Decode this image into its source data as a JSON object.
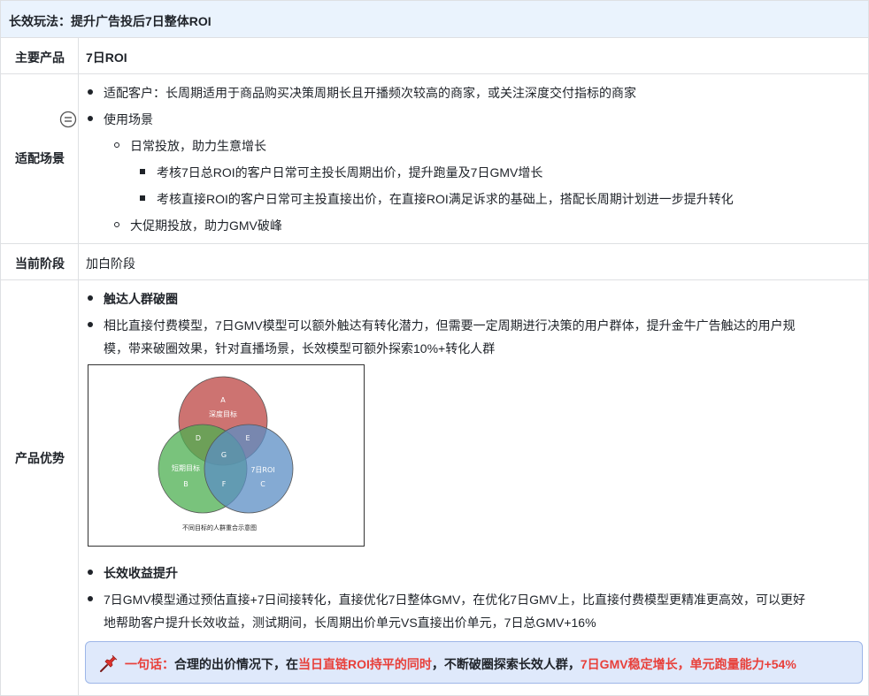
{
  "header": {
    "title": "长效玩法：提升广告投后7日整体ROI"
  },
  "rows": {
    "product": {
      "label": "主要产品",
      "value": "7日ROI"
    },
    "scene": {
      "label": "适配场景",
      "b1": "适配客户：长周期适用于商品购买决策周期长且开播频次较高的商家，或关注深度交付指标的商家",
      "b2": "使用场景",
      "s1": "日常投放，助力生意增长",
      "t1": "考核7日总ROI的客户日常可主投长周期出价，提升跑量及7日GMV增长",
      "t2": "考核直接ROI的客户日常可主投直接出价，在直接ROI满足诉求的基础上，搭配长周期计划进一步提升转化",
      "s2": "大促期投放，助力GMV破峰"
    },
    "stage": {
      "label": "当前阶段",
      "value": "加白阶段"
    },
    "advantage": {
      "label": "产品优势",
      "h1": "触达人群破圈",
      "p1_line1": "相比直接付费模型，7日GMV模型可以额外触达有转化潜力，但需要一定周期进行决策的用户群体，提升金牛广告触达的用户规",
      "p1_line2": "模，带来破圈效果，针对直播场景，长效模型可额外探索10%+转化人群",
      "venn": {
        "A": "A",
        "B": "B",
        "C": "C",
        "D": "D",
        "E": "E",
        "F": "F",
        "G": "G",
        "deep": "深度目标",
        "short": "短期目标",
        "roi7": "7日ROI",
        "caption": "不同目标的人群重合示意图",
        "colors": {
          "red": "#c0504d",
          "green": "#4caf50",
          "blue": "#5b8ec4"
        }
      },
      "h2": "长效收益提升",
      "p2_line1": "7日GMV模型通过预估直接+7日间接转化，直接优化7日整体GMV，在优化7日GMV上，比直接付费模型更精准更高效，可以更好",
      "p2_line2": "地帮助客户提升长效收益，测试期间，长周期出价单元VS直接出价单元，7日总GMV+16%"
    },
    "callout": {
      "icon": "pushpin-icon",
      "lead": "一句话：",
      "part1": "合理的出价情况下，在",
      "hl1": "当日直链ROI持平的同时",
      "part2": "，不断破圈探索长效人群，",
      "hl2": "7日GMV稳定增长，单元跑量能力+54%"
    }
  },
  "side_icon": "list-menu-icon"
}
